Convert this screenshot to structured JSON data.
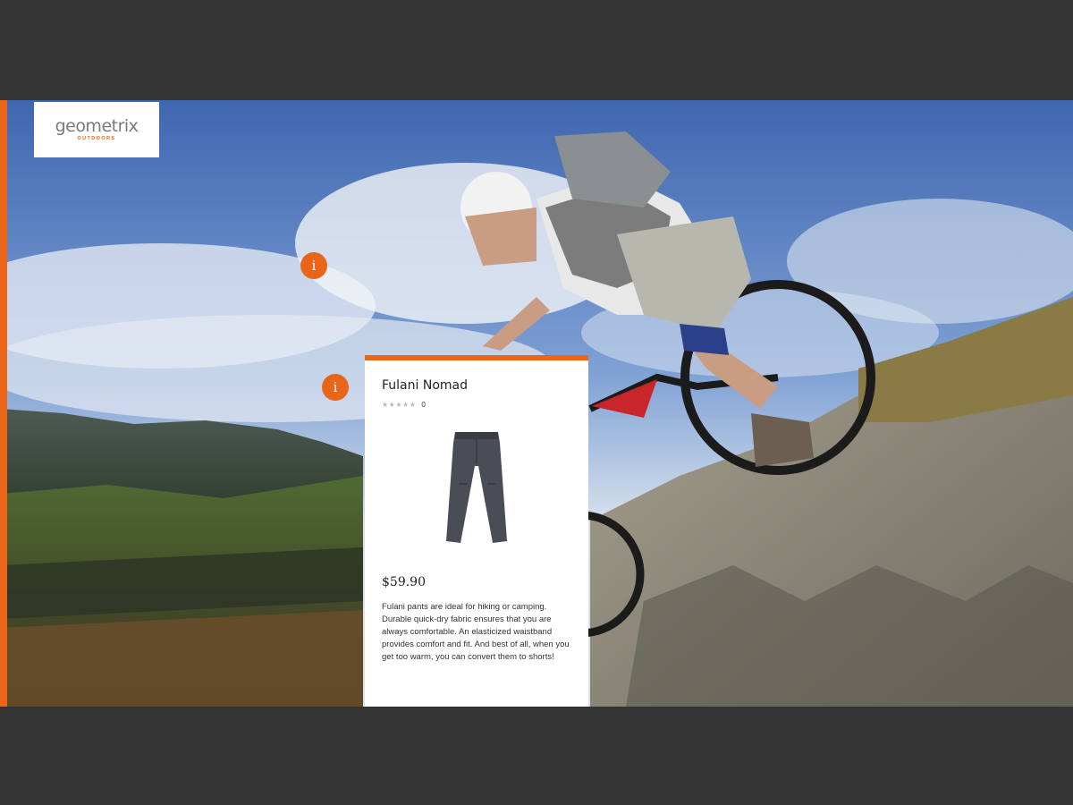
{
  "colors": {
    "accent": "#e8651a",
    "frame_background": "#333333",
    "card_background": "#ffffff"
  },
  "logo": {
    "name": "geometrix",
    "tagline": "OUTDOORS"
  },
  "hotspots": [
    {
      "icon": "info-icon",
      "glyph": "i"
    },
    {
      "icon": "info-icon",
      "glyph": "i"
    }
  ],
  "product": {
    "name": "Fulani Nomad",
    "rating_stars": "★★★★★",
    "review_count": "0",
    "image_icon": "pants-icon",
    "price": "$59.90",
    "description": "Fulani pants are ideal for hiking or camping. Durable quick-dry fabric ensures that you are always comfortable. An elasticized waistband provides comfort and fit. And best of all, when you get too warm, you can convert them to shorts!"
  }
}
